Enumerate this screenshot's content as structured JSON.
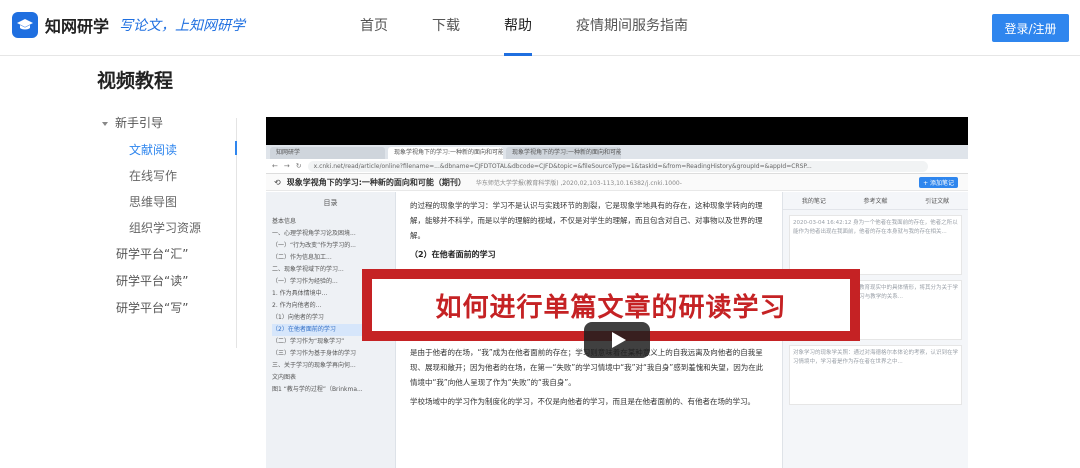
{
  "header": {
    "logo_text": "知网研学",
    "slogan": "写论文，上知网研学",
    "nav": [
      "首页",
      "下载",
      "帮助",
      "疫情期间服务指南"
    ],
    "active_nav": "帮助",
    "login_label": "登录/注册"
  },
  "page_title": "视频教程",
  "sidebar": {
    "group_open": "新手引导",
    "sub_items": [
      "文献阅读",
      "在线写作",
      "思维导图",
      "组织学习资源"
    ],
    "active_sub": "文献阅读",
    "groups": [
      "研学平台“汇”",
      "研学平台“读”",
      "研学平台“写”"
    ]
  },
  "video": {
    "banner_text": "如何进行单篇文章的研读学习",
    "screen": {
      "tabs": [
        "知网研学",
        "现象学视角下的学习:一种新的面向和可能",
        "现象学视角下的学习:一种新的面向和可能"
      ],
      "url": "x.cnki.net/read/article/online?filename=...&dbname=CJFDTOTAL&dbcode=CJFD&topic=&fileSourceType=1&taskId=&from=ReadingHistory&groupId=&appId=CRSP...",
      "doc_title": "现象学视角下的学习:一种新的面向和可能（期刊）",
      "doc_meta": "华东师范大学学报(教育科学版) ,2020,02,103-113,10.16382/j.cnki.1000-",
      "badge": "+ 添加笔记",
      "toc_title": "目录",
      "toc": [
        "基本信息",
        "一、心理学视角学习论及困境...",
        "（一）“行为改变”作为学习的...",
        "（二）作为信息加工...",
        "二、现象学视域下的学习...",
        "（一）学习作为经验的...",
        "1. 作为具体情境中...",
        "2. 作为向他者的...",
        "（1）向他者的学习",
        "（2）在他者面前的学习",
        "（二）学习作为“现象学习”",
        "（三）学习作为基于身体的学习",
        "三、关于学习的现象学再向何...",
        "文内图表",
        "图1 “教与学的过程”（Brinkma..."
      ],
      "toc_selected": "（2）在他者面前的学习",
      "paragraphs": [
        "的过程的现象学的学习：学习不是认识与实践环节的割裂，它是现象学地具有的存在，这种现象学转向的理解，能够并不科学，而是以学的理解的视域，不仅是对学生的理解，而且包含对自己、对事物以及世界的理解。",
        "学校场域中的学习作为制度化的学习，不仅是向他者的学习，而且是在他者面前的、有他者在场的学习。正是由于他者的在场，“我”成为在他者面前的存在；学习则意味着在某种意义上的自我远离及向他者的自我呈现、展现和敞开；因为他者的在场，在第一“失败”的学习情境中“我”对“我自身”感到羞愧和失望，因为在此情境中“我”向他人呈现了作为“失败”的“我自身”。",
        "学校场域中的学习作为制度化的学习，不仅是向他者的学习，而且是在他者面前的、有他者在场的学习。"
      ],
      "section": "（2）在他者面前的学习",
      "note_tabs": [
        "我的笔记",
        "参考文献",
        "引证文献"
      ],
      "note_texts": [
        "2020-03-04 16:42:12 身为一个他者在我面前的存在，他者之所以能作为他者出现在我面前，他者的存在本身就与我的存在相关...",
        "据知识学习的理论化发展和教育现实中的具体情形，将其分为关于学习的“他者”，对于他者中学习与教学的关系...",
        "对象学习的现象学关照：通过对海德格尔本体论的考察，认识到在学习情境中，学习者是作为存在者在世界之中..."
      ]
    }
  }
}
